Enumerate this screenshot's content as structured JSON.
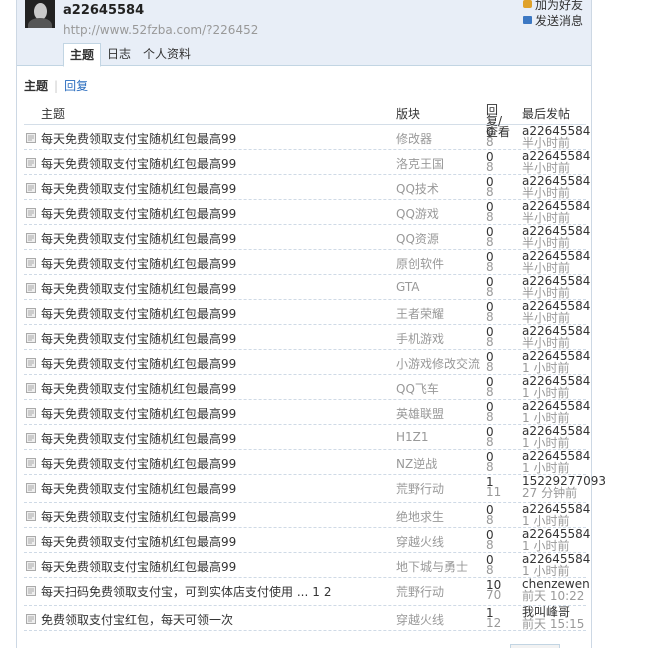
{
  "profile": {
    "username": "a22645584",
    "url": "http://www.52fzba.com/?226452",
    "add_friend": "加为好友",
    "send_message": "发送消息"
  },
  "tabs": [
    "主题",
    "日志",
    "个人资料"
  ],
  "subtabs": {
    "topics": "主题",
    "replies": "回复"
  },
  "columns": {
    "topic": "主题",
    "forum": "版块",
    "counts": "回复/查看",
    "last": "最后发帖"
  },
  "rows": [
    {
      "title": "每天免费领取支付宝随机红包最高99",
      "forum": "修改器",
      "replies": "0",
      "views": "8",
      "last_user": "a22645584",
      "last_time": "半小时前"
    },
    {
      "title": "每天免费领取支付宝随机红包最高99",
      "forum": "洛克王国",
      "replies": "0",
      "views": "8",
      "last_user": "a22645584",
      "last_time": "半小时前"
    },
    {
      "title": "每天免费领取支付宝随机红包最高99",
      "forum": "QQ技术",
      "replies": "0",
      "views": "8",
      "last_user": "a22645584",
      "last_time": "半小时前"
    },
    {
      "title": "每天免费领取支付宝随机红包最高99",
      "forum": "QQ游戏",
      "replies": "0",
      "views": "8",
      "last_user": "a22645584",
      "last_time": "半小时前"
    },
    {
      "title": "每天免费领取支付宝随机红包最高99",
      "forum": "QQ资源",
      "replies": "0",
      "views": "8",
      "last_user": "a22645584",
      "last_time": "半小时前"
    },
    {
      "title": "每天免费领取支付宝随机红包最高99",
      "forum": "原创软件",
      "replies": "0",
      "views": "8",
      "last_user": "a22645584",
      "last_time": "半小时前"
    },
    {
      "title": "每天免费领取支付宝随机红包最高99",
      "forum": "GTA",
      "replies": "0",
      "views": "8",
      "last_user": "a22645584",
      "last_time": "半小时前"
    },
    {
      "title": "每天免费领取支付宝随机红包最高99",
      "forum": "王者荣耀",
      "replies": "0",
      "views": "8",
      "last_user": "a22645584",
      "last_time": "半小时前"
    },
    {
      "title": "每天免费领取支付宝随机红包最高99",
      "forum": "手机游戏",
      "replies": "0",
      "views": "8",
      "last_user": "a22645584",
      "last_time": "半小时前"
    },
    {
      "title": "每天免费领取支付宝随机红包最高99",
      "forum": "小游戏修改交流",
      "replies": "0",
      "views": "8",
      "last_user": "a22645584",
      "last_time": "1 小时前"
    },
    {
      "title": "每天免费领取支付宝随机红包最高99",
      "forum": "QQ飞车",
      "replies": "0",
      "views": "8",
      "last_user": "a22645584",
      "last_time": "1 小时前"
    },
    {
      "title": "每天免费领取支付宝随机红包最高99",
      "forum": "英雄联盟",
      "replies": "0",
      "views": "8",
      "last_user": "a22645584",
      "last_time": "1 小时前"
    },
    {
      "title": "每天免费领取支付宝随机红包最高99",
      "forum": "H1Z1",
      "replies": "0",
      "views": "8",
      "last_user": "a22645584",
      "last_time": "1 小时前"
    },
    {
      "title": "每天免费领取支付宝随机红包最高99",
      "forum": "NZ逆战",
      "replies": "0",
      "views": "8",
      "last_user": "a22645584",
      "last_time": "1 小时前"
    },
    {
      "title": "每天免费领取支付宝随机红包最高99",
      "forum": "荒野行动",
      "replies": "1",
      "views": "11",
      "last_user": "15229277093",
      "last_time": "27 分钟前",
      "tall": true
    },
    {
      "title": "每天免费领取支付宝随机红包最高99",
      "forum": "绝地求生",
      "replies": "0",
      "views": "8",
      "last_user": "a22645584",
      "last_time": "1 小时前"
    },
    {
      "title": "每天免费领取支付宝随机红包最高99",
      "forum": "穿越火线",
      "replies": "0",
      "views": "8",
      "last_user": "a22645584",
      "last_time": "1 小时前"
    },
    {
      "title": "每天免费领取支付宝随机红包最高99",
      "forum": "地下城与勇士",
      "replies": "0",
      "views": "8",
      "last_user": "a22645584",
      "last_time": "1 小时前"
    },
    {
      "title": "每天扫码免费领取支付宝，可到实体店支付使用 ...",
      "pages": [
        "1",
        "2"
      ],
      "forum": "荒野行动",
      "replies": "10",
      "views": "70",
      "last_user": "chenzewen",
      "last_time": "前天 10:22",
      "tall": true
    },
    {
      "title": "免费领取支付宝红包，每天可领一次",
      "forum": "穿越火线",
      "replies": "1",
      "views": "12",
      "last_user": "我叫峰哥",
      "last_time": "前天 15:15"
    }
  ]
}
